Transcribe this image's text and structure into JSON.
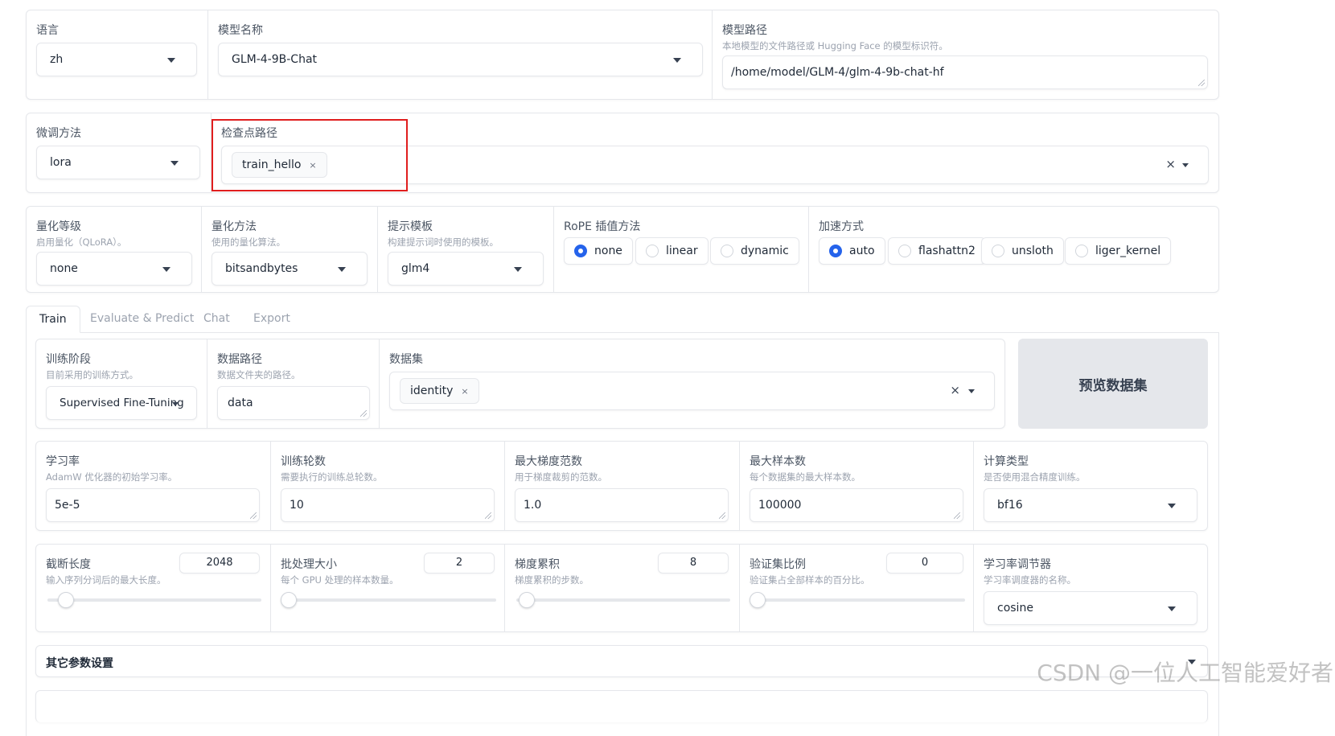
{
  "top": {
    "lang_label": "语言",
    "lang_value": "zh",
    "model_name_label": "模型名称",
    "model_name_value": "GLM-4-9B-Chat",
    "model_path_label": "模型路径",
    "model_path_info": "本地模型的文件路径或 Hugging Face 的模型标识符。",
    "model_path_value": "/home/model/GLM-4/glm-4-9b-chat-hf"
  },
  "finetune": {
    "method_label": "微调方法",
    "method_value": "lora",
    "ckpt_label": "检查点路径",
    "ckpt_chip": "train_hello",
    "chip_remove": "×",
    "clear": "×"
  },
  "advanced": {
    "quant_bit_label": "量化等级",
    "quant_bit_info": "启用量化（QLoRA）。",
    "quant_bit_value": "none",
    "quant_method_label": "量化方法",
    "quant_method_info": "使用的量化算法。",
    "quant_method_value": "bitsandbytes",
    "template_label": "提示模板",
    "template_info": "构建提示词时使用的模板。",
    "template_value": "glm4",
    "rope_label": "RoPE 插值方法",
    "rope_options": [
      "none",
      "linear",
      "dynamic"
    ],
    "rope_selected": "none",
    "booster_label": "加速方式",
    "booster_options": [
      "auto",
      "flashattn2",
      "unsloth",
      "liger_kernel"
    ],
    "booster_selected": "auto"
  },
  "tabs": [
    "Train",
    "Evaluate & Predict",
    "Chat",
    "Export"
  ],
  "active_tab": "Train",
  "train": {
    "stage_label": "训练阶段",
    "stage_info": "目前采用的训练方式。",
    "stage_value": "Supervised Fine-Tuning",
    "dataset_dir_label": "数据路径",
    "dataset_dir_info": "数据文件夹的路径。",
    "dataset_dir_value": "data",
    "dataset_label": "数据集",
    "dataset_chip": "identity",
    "chip_remove": "×",
    "clear": "×",
    "preview_button": "预览数据集",
    "lr_label": "学习率",
    "lr_info": "AdamW 优化器的初始学习率。",
    "lr_value": "5e-5",
    "epochs_label": "训练轮数",
    "epochs_info": "需要执行的训练总轮数。",
    "epochs_value": "10",
    "maxgrad_label": "最大梯度范数",
    "maxgrad_info": "用于梯度裁剪的范数。",
    "maxgrad_value": "1.0",
    "maxsamples_label": "最大样本数",
    "maxsamples_info": "每个数据集的最大样本数。",
    "maxsamples_value": "100000",
    "compute_label": "计算类型",
    "compute_info": "是否使用混合精度训练。",
    "compute_value": "bf16",
    "cutoff_label": "截断长度",
    "cutoff_info": "输入序列分词后的最大长度。",
    "cutoff_value": "2048",
    "cutoff_level": 0.06,
    "batch_label": "批处理大小",
    "batch_info": "每个 GPU 处理的样本数量。",
    "batch_value": "2",
    "batch_level": 0.0,
    "gradaccum_label": "梯度累积",
    "gradaccum_info": "梯度累积的步数。",
    "gradaccum_value": "8",
    "gradaccum_level": 0.02,
    "valsize_label": "验证集比例",
    "valsize_info": "验证集占全部样本的百分比。",
    "valsize_value": "0",
    "valsize_level": 0.0,
    "scheduler_label": "学习率调节器",
    "scheduler_info": "学习率调度器的名称。",
    "scheduler_value": "cosine",
    "other_settings": "其它参数设置"
  },
  "watermark": "CSDN @一位人工智能爱好者"
}
